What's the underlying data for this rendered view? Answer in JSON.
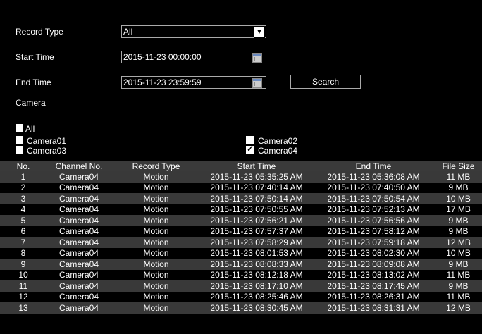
{
  "form": {
    "record_type_label": "Record Type",
    "record_type_value": "All",
    "start_time_label": "Start Time",
    "start_time_value": "2015-11-23 00:00:00",
    "end_time_label": "End Time",
    "end_time_value": "2015-11-23 23:59:59",
    "search_label": "Search",
    "camera_label": "Camera"
  },
  "cameras": {
    "all_label": "All",
    "camera01_label": "Camera01",
    "camera02_label": "Camera02",
    "camera03_label": "Camera03",
    "camera04_label": "Camera04"
  },
  "table": {
    "headers": [
      "No.",
      "Channel No.",
      "Record Type",
      "Start Time",
      "End Time",
      "File Size"
    ],
    "rows": [
      [
        "1",
        "Camera04",
        "Motion",
        "2015-11-23 05:35:25 AM",
        "2015-11-23 05:36:08 AM",
        "11 MB"
      ],
      [
        "2",
        "Camera04",
        "Motion",
        "2015-11-23 07:40:14 AM",
        "2015-11-23 07:40:50 AM",
        "9 MB"
      ],
      [
        "3",
        "Camera04",
        "Motion",
        "2015-11-23 07:50:14 AM",
        "2015-11-23 07:50:54 AM",
        "10 MB"
      ],
      [
        "4",
        "Camera04",
        "Motion",
        "2015-11-23 07:50:55 AM",
        "2015-11-23 07:52:13 AM",
        "17 MB"
      ],
      [
        "5",
        "Camera04",
        "Motion",
        "2015-11-23 07:56:21 AM",
        "2015-11-23 07:56:56 AM",
        "9 MB"
      ],
      [
        "6",
        "Camera04",
        "Motion",
        "2015-11-23 07:57:37 AM",
        "2015-11-23 07:58:12 AM",
        "9 MB"
      ],
      [
        "7",
        "Camera04",
        "Motion",
        "2015-11-23 07:58:29 AM",
        "2015-11-23 07:59:18 AM",
        "12 MB"
      ],
      [
        "8",
        "Camera04",
        "Motion",
        "2015-11-23 08:01:53 AM",
        "2015-11-23 08:02:30 AM",
        "10 MB"
      ],
      [
        "9",
        "Camera04",
        "Motion",
        "2015-11-23 08:08:33 AM",
        "2015-11-23 08:09:08 AM",
        "9 MB"
      ],
      [
        "10",
        "Camera04",
        "Motion",
        "2015-11-23 08:12:18 AM",
        "2015-11-23 08:13:02 AM",
        "11 MB"
      ],
      [
        "11",
        "Camera04",
        "Motion",
        "2015-11-23 08:17:10 AM",
        "2015-11-23 08:17:45 AM",
        "9 MB"
      ],
      [
        "12",
        "Camera04",
        "Motion",
        "2015-11-23 08:25:46 AM",
        "2015-11-23 08:26:31 AM",
        "11 MB"
      ],
      [
        "13",
        "Camera04",
        "Motion",
        "2015-11-23 08:30:45 AM",
        "2015-11-23 08:31:31 AM",
        "12 MB"
      ]
    ]
  }
}
